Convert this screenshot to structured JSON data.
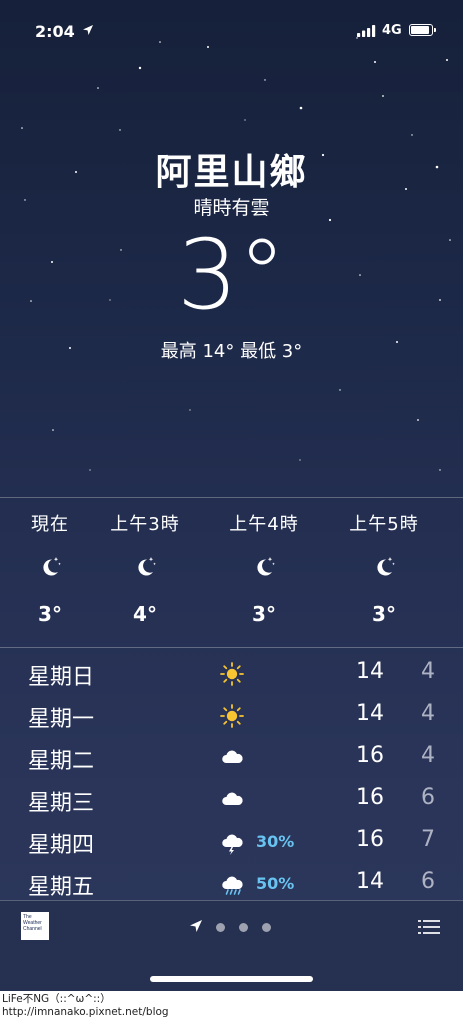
{
  "status_bar": {
    "time": "2:04",
    "network": "4G",
    "battery_level": 0.95
  },
  "location": {
    "city": "阿里山鄉",
    "condition": "晴時有雲",
    "temperature": "3°",
    "high_low": "最高 14°  最低 3°"
  },
  "hourly": [
    {
      "label": "現在",
      "icon": "moon-stars-icon",
      "temp": "3°"
    },
    {
      "label": "上午3時",
      "icon": "moon-stars-icon",
      "temp": "4°"
    },
    {
      "label": "上午4時",
      "icon": "moon-stars-icon",
      "temp": "3°"
    },
    {
      "label": "上午5時",
      "icon": "moon-stars-icon",
      "temp": "3°"
    }
  ],
  "daily": [
    {
      "day": "星期日",
      "icon": "sun-icon",
      "precip": "",
      "high": "14",
      "low": "4"
    },
    {
      "day": "星期一",
      "icon": "sun-icon",
      "precip": "",
      "high": "14",
      "low": "4"
    },
    {
      "day": "星期二",
      "icon": "cloud-icon",
      "precip": "",
      "high": "16",
      "low": "4"
    },
    {
      "day": "星期三",
      "icon": "cloud-icon",
      "precip": "",
      "high": "16",
      "low": "6"
    },
    {
      "day": "星期四",
      "icon": "thunderstorm-icon",
      "precip": "30%",
      "high": "16",
      "low": "7"
    },
    {
      "day": "星期五",
      "icon": "rain-icon",
      "precip": "50%",
      "high": "14",
      "low": "6"
    }
  ],
  "footer": {
    "logo_text": "The Weather Channel",
    "pages": 3,
    "current_page": 0
  },
  "credit": {
    "line1": "LiFe不NG（::^ω^::）",
    "line2": "http://imnanako.pixnet.net/blog"
  },
  "colors": {
    "background_top": "#16203a",
    "background_bottom": "#2b365a",
    "precip_blue": "#69c3f1",
    "low_temp_gray": "#aeb3c4"
  }
}
